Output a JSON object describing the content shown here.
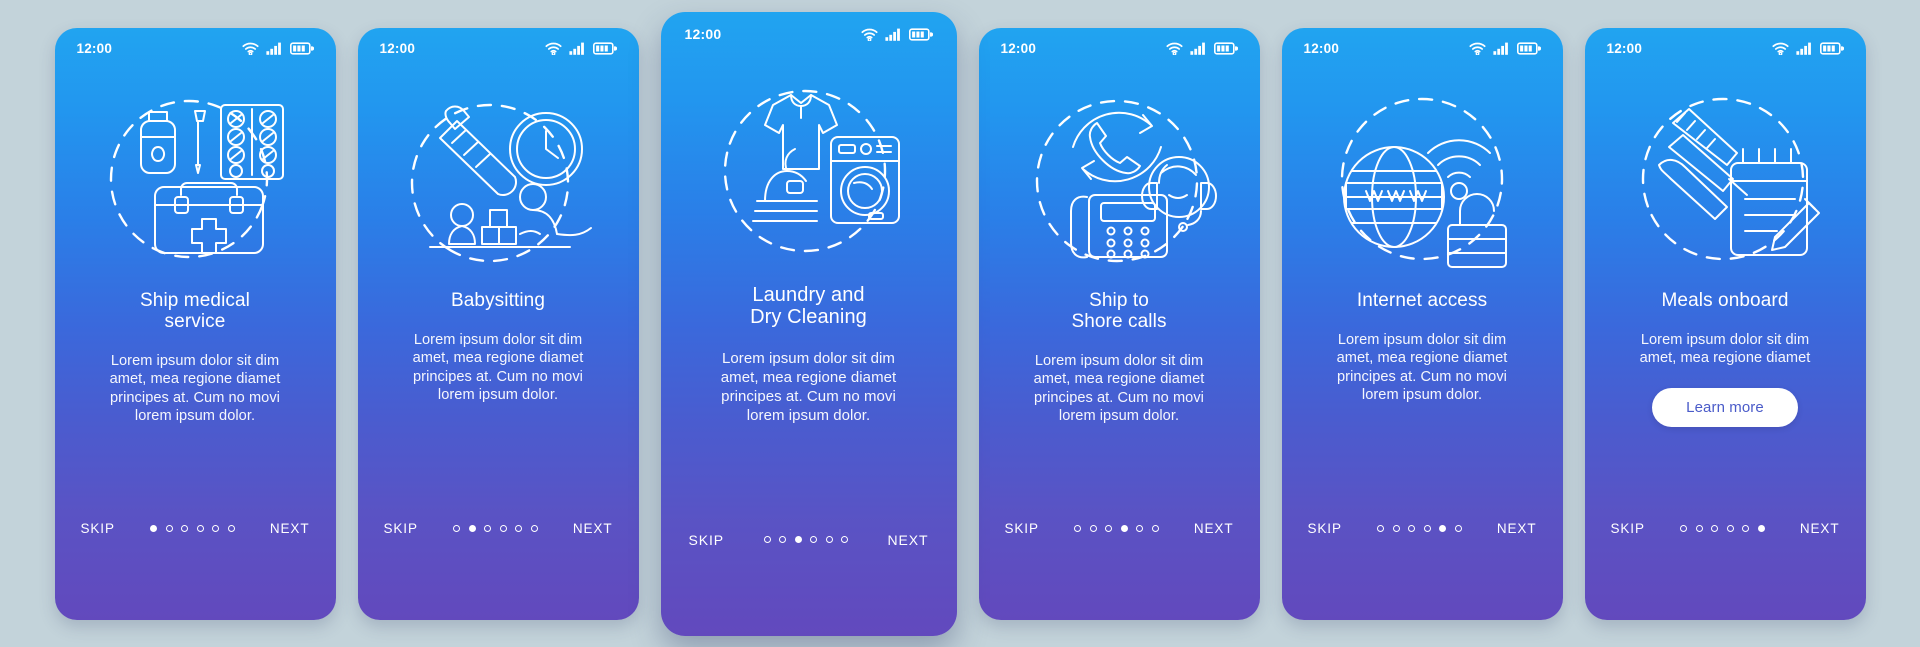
{
  "page": {
    "background_color": "#c3d3da",
    "card_gradient_top": "#21a4f0",
    "card_gradient_bottom": "#6249bd",
    "accent_text_color": "#ffffff",
    "button_text_color": "#4a5bc9"
  },
  "status_bar": {
    "time": "12:00",
    "icons": [
      "wifi-icon",
      "cellular-signal-icon",
      "battery-icon"
    ]
  },
  "nav": {
    "skip_label": "SKIP",
    "next_label": "NEXT",
    "total_dots": 6
  },
  "screens": [
    {
      "index": 1,
      "featured": false,
      "icon_name": "medical-kit-icon",
      "title": "Ship medical service",
      "title_lines": [
        "Ship medical",
        "service"
      ],
      "description": "Lorem ipsum dolor sit dim amet, mea regione diamet principes at. Cum no movi lorem ipsum dolor.",
      "description_lines": [
        "Lorem ipsum dolor sit dim",
        "amet, mea regione diamet",
        "principes at. Cum no movi",
        "lorem ipsum dolor."
      ],
      "active_dot": 1,
      "cta": null
    },
    {
      "index": 2,
      "featured": false,
      "icon_name": "babysitting-icon",
      "title": "Babysitting",
      "title_lines": [
        "Babysitting"
      ],
      "description": "Lorem ipsum dolor sit dim amet, mea regione diamet principes at. Cum no movi lorem ipsum dolor.",
      "description_lines": [
        "Lorem ipsum dolor sit dim",
        "amet, mea regione diamet",
        "principes at. Cum no movi",
        "lorem ipsum dolor."
      ],
      "active_dot": 2,
      "cta": null
    },
    {
      "index": 3,
      "featured": true,
      "icon_name": "laundry-icon",
      "title": "Laundry and Dry Cleaning",
      "title_lines": [
        "Laundry and",
        "Dry Cleaning"
      ],
      "description": "Lorem ipsum dolor sit dim amet, mea regione diamet principes at. Cum no movi lorem ipsum dolor.",
      "description_lines": [
        "Lorem ipsum dolor sit dim",
        "amet, mea regione diamet",
        "principes at. Cum no movi",
        "lorem ipsum dolor."
      ],
      "active_dot": 3,
      "cta": null
    },
    {
      "index": 4,
      "featured": false,
      "icon_name": "ship-to-shore-call-icon",
      "title": "Ship to Shore calls",
      "title_lines": [
        "Ship to",
        "Shore calls"
      ],
      "description": "Lorem ipsum dolor sit dim amet, mea regione diamet principes at. Cum no movi lorem ipsum dolor.",
      "description_lines": [
        "Lorem ipsum dolor sit dim",
        "amet, mea regione diamet",
        "principes at. Cum no movi",
        "lorem ipsum dolor."
      ],
      "active_dot": 4,
      "cta": null
    },
    {
      "index": 5,
      "featured": false,
      "icon_name": "internet-access-icon",
      "title": "Internet access",
      "title_lines": [
        "Internet access"
      ],
      "description": "Lorem ipsum dolor sit dim amet, mea regione diamet principes at. Cum no movi lorem ipsum dolor.",
      "description_lines": [
        "Lorem ipsum dolor sit dim",
        "amet, mea regione diamet",
        "principes at. Cum no movi",
        "lorem ipsum dolor."
      ],
      "active_dot": 5,
      "cta": null
    },
    {
      "index": 6,
      "featured": false,
      "icon_name": "meals-onboard-icon",
      "title": "Meals onboard",
      "title_lines": [
        "Meals onboard"
      ],
      "description": "Lorem ipsum dolor sit dim amet, mea regione diamet",
      "description_lines": [
        "Lorem ipsum dolor sit dim",
        "amet, mea regione diamet"
      ],
      "active_dot": 6,
      "cta": "Learn more"
    }
  ]
}
